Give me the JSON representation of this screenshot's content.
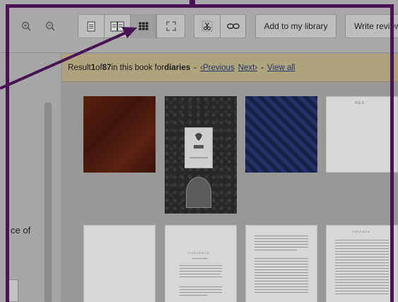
{
  "toolbar": {
    "zoom_in_icon": "zoom-in-icon",
    "zoom_out_icon": "zoom-out-icon",
    "add_to_library_label": "Add to my library",
    "write_review_label": "Write review"
  },
  "results": {
    "prefix": "Result ",
    "current": "1",
    "of_text": " of ",
    "total": "87",
    "in_book_text": " in this book for ",
    "query": "diaries",
    "dash": "-",
    "previous": "‹Previous",
    "next": "Next›",
    "view_all": "View all"
  },
  "left_panel": {
    "cut_text": "ce of"
  },
  "thumb_texts": {
    "p4_header": "R E S .",
    "p7_header": "CONTENTS",
    "p8_header": "PREFACE"
  },
  "colors": {
    "annotation": "#4a1357"
  }
}
